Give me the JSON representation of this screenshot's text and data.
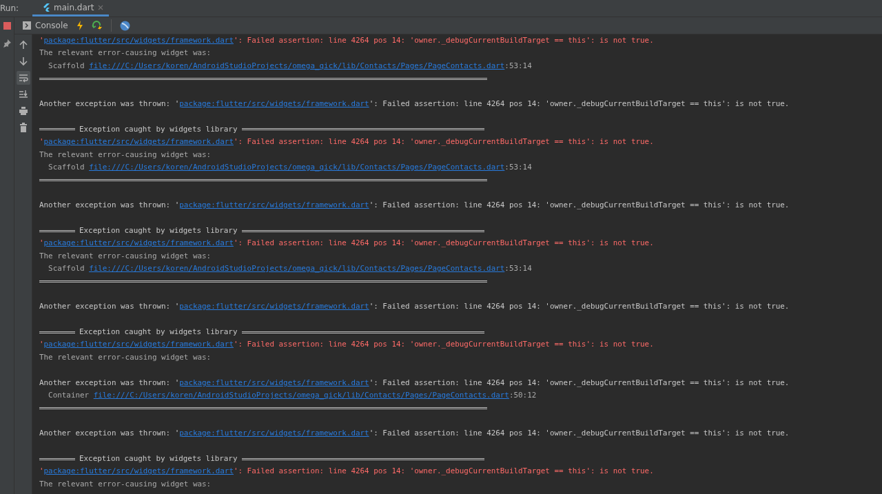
{
  "run_bar": {
    "label": "Run:",
    "tabs": [
      {
        "label": "main.dart",
        "selected": true
      }
    ]
  },
  "toolbar": {
    "console_tab": "Console"
  },
  "side_tools": [
    {
      "kind": "up",
      "selected": false
    },
    {
      "kind": "down",
      "selected": false
    },
    {
      "kind": "wrap",
      "selected": true
    },
    {
      "kind": "scroll-end",
      "selected": false
    },
    {
      "kind": "print",
      "selected": false
    },
    {
      "kind": "trash",
      "selected": false
    }
  ],
  "console_lines": [
    {
      "kind": "assert",
      "prefix": "'",
      "link": "package:flutter/src/widgets/framework.dart",
      "suffix": "': Failed assertion: line 4264 pos 14: 'owner._debugCurrentBuildTarget == this': is not true."
    },
    {
      "kind": "relevant",
      "text": "The relevant error-causing widget was:"
    },
    {
      "kind": "widget",
      "name": "Scaffold",
      "link": "file:///C:/Users/koren/AndroidStudioProjects/omega_qick/lib/Contacts/Pages/PageContacts.dart",
      "suffix": ":53:14"
    },
    {
      "kind": "rule"
    },
    {
      "kind": "blank"
    },
    {
      "kind": "thrown",
      "prefix": "Another exception was thrown: '",
      "link": "package:flutter/src/widgets/framework.dart",
      "suffix": "': Failed assertion: line 4264 pos 14: 'owner._debugCurrentBuildTarget == this': is not true."
    },
    {
      "kind": "blank"
    },
    {
      "kind": "header",
      "text": "Exception caught by widgets library"
    },
    {
      "kind": "assert",
      "prefix": "'",
      "link": "package:flutter/src/widgets/framework.dart",
      "suffix": "': Failed assertion: line 4264 pos 14: 'owner._debugCurrentBuildTarget == this': is not true."
    },
    {
      "kind": "relevant",
      "text": "The relevant error-causing widget was:"
    },
    {
      "kind": "widget",
      "name": "Scaffold",
      "link": "file:///C:/Users/koren/AndroidStudioProjects/omega_qick/lib/Contacts/Pages/PageContacts.dart",
      "suffix": ":53:14"
    },
    {
      "kind": "rule"
    },
    {
      "kind": "blank"
    },
    {
      "kind": "thrown",
      "prefix": "Another exception was thrown: '",
      "link": "package:flutter/src/widgets/framework.dart",
      "suffix": "': Failed assertion: line 4264 pos 14: 'owner._debugCurrentBuildTarget == this': is not true."
    },
    {
      "kind": "blank"
    },
    {
      "kind": "header",
      "text": "Exception caught by widgets library"
    },
    {
      "kind": "assert",
      "prefix": "'",
      "link": "package:flutter/src/widgets/framework.dart",
      "suffix": "': Failed assertion: line 4264 pos 14: 'owner._debugCurrentBuildTarget == this': is not true."
    },
    {
      "kind": "relevant",
      "text": "The relevant error-causing widget was:"
    },
    {
      "kind": "widget",
      "name": "Scaffold",
      "link": "file:///C:/Users/koren/AndroidStudioProjects/omega_qick/lib/Contacts/Pages/PageContacts.dart",
      "suffix": ":53:14"
    },
    {
      "kind": "rule"
    },
    {
      "kind": "blank"
    },
    {
      "kind": "thrown",
      "prefix": "Another exception was thrown: '",
      "link": "package:flutter/src/widgets/framework.dart",
      "suffix": "': Failed assertion: line 4264 pos 14: 'owner._debugCurrentBuildTarget == this': is not true."
    },
    {
      "kind": "blank"
    },
    {
      "kind": "header",
      "text": "Exception caught by widgets library"
    },
    {
      "kind": "assert",
      "prefix": "'",
      "link": "package:flutter/src/widgets/framework.dart",
      "suffix": "': Failed assertion: line 4264 pos 14: 'owner._debugCurrentBuildTarget == this': is not true."
    },
    {
      "kind": "relevant",
      "text": "The relevant error-causing widget was:"
    },
    {
      "kind": "blank"
    },
    {
      "kind": "thrown",
      "prefix": "Another exception was thrown: '",
      "link": "package:flutter/src/widgets/framework.dart",
      "suffix": "': Failed assertion: line 4264 pos 14: 'owner._debugCurrentBuildTarget == this': is not true."
    },
    {
      "kind": "widget",
      "name": "Container",
      "link": "file:///C:/Users/koren/AndroidStudioProjects/omega_qick/lib/Contacts/Pages/PageContacts.dart",
      "suffix": ":50:12"
    },
    {
      "kind": "rule"
    },
    {
      "kind": "blank"
    },
    {
      "kind": "thrown",
      "prefix": "Another exception was thrown: '",
      "link": "package:flutter/src/widgets/framework.dart",
      "suffix": "': Failed assertion: line 4264 pos 14: 'owner._debugCurrentBuildTarget == this': is not true."
    },
    {
      "kind": "blank"
    },
    {
      "kind": "header",
      "text": "Exception caught by widgets library"
    },
    {
      "kind": "assert",
      "prefix": "'",
      "link": "package:flutter/src/widgets/framework.dart",
      "suffix": "': Failed assertion: line 4264 pos 14: 'owner._debugCurrentBuildTarget == this': is not true."
    },
    {
      "kind": "relevant",
      "text": "The relevant error-causing widget was:"
    }
  ]
}
